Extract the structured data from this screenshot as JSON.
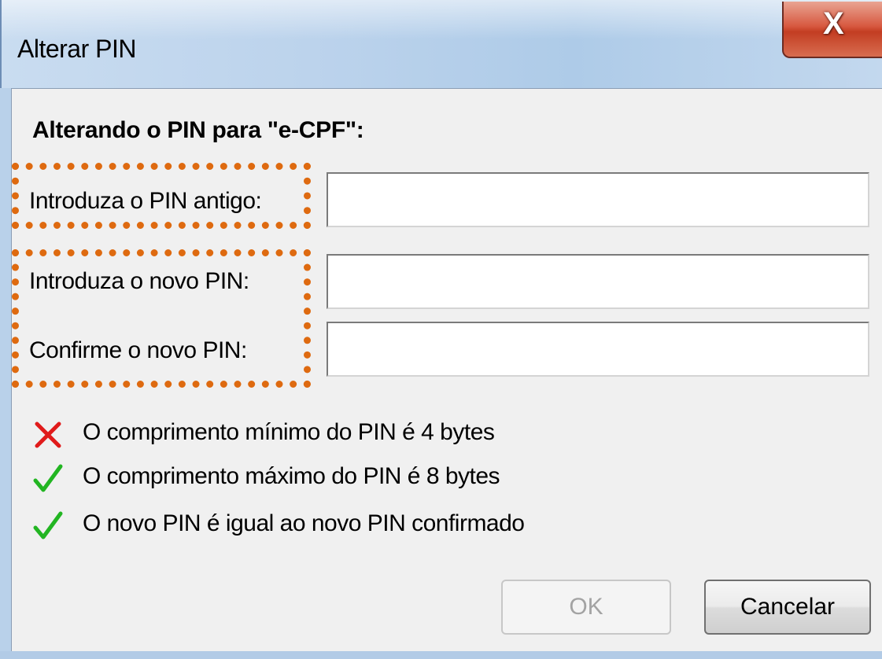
{
  "window": {
    "title": "Alterar PIN",
    "close_glyph": "X"
  },
  "dialog": {
    "heading": "Alterando o PIN para \"e-CPF\":",
    "fields": {
      "old_pin": {
        "label": "Introduza o PIN antigo:",
        "value": ""
      },
      "new_pin": {
        "label": "Introduza o novo PIN:",
        "value": ""
      },
      "confirm_pin": {
        "label": "Confirme o novo PIN:",
        "value": ""
      }
    },
    "rules": [
      {
        "status": "fail",
        "icon": "red-x-icon",
        "text": "O comprimento mínimo do PIN é 4 bytes"
      },
      {
        "status": "pass",
        "icon": "green-check-icon",
        "text": "O comprimento máximo do PIN é 8 bytes"
      },
      {
        "status": "pass",
        "icon": "green-check-icon",
        "text": "O novo PIN é igual ao novo PIN confirmado"
      }
    ]
  },
  "buttons": {
    "ok_label": "OK",
    "ok_enabled": false,
    "cancel_label": "Cancelar"
  },
  "colors": {
    "highlight": "#de6a10",
    "fail": "#e01b1b",
    "pass": "#22b522"
  }
}
